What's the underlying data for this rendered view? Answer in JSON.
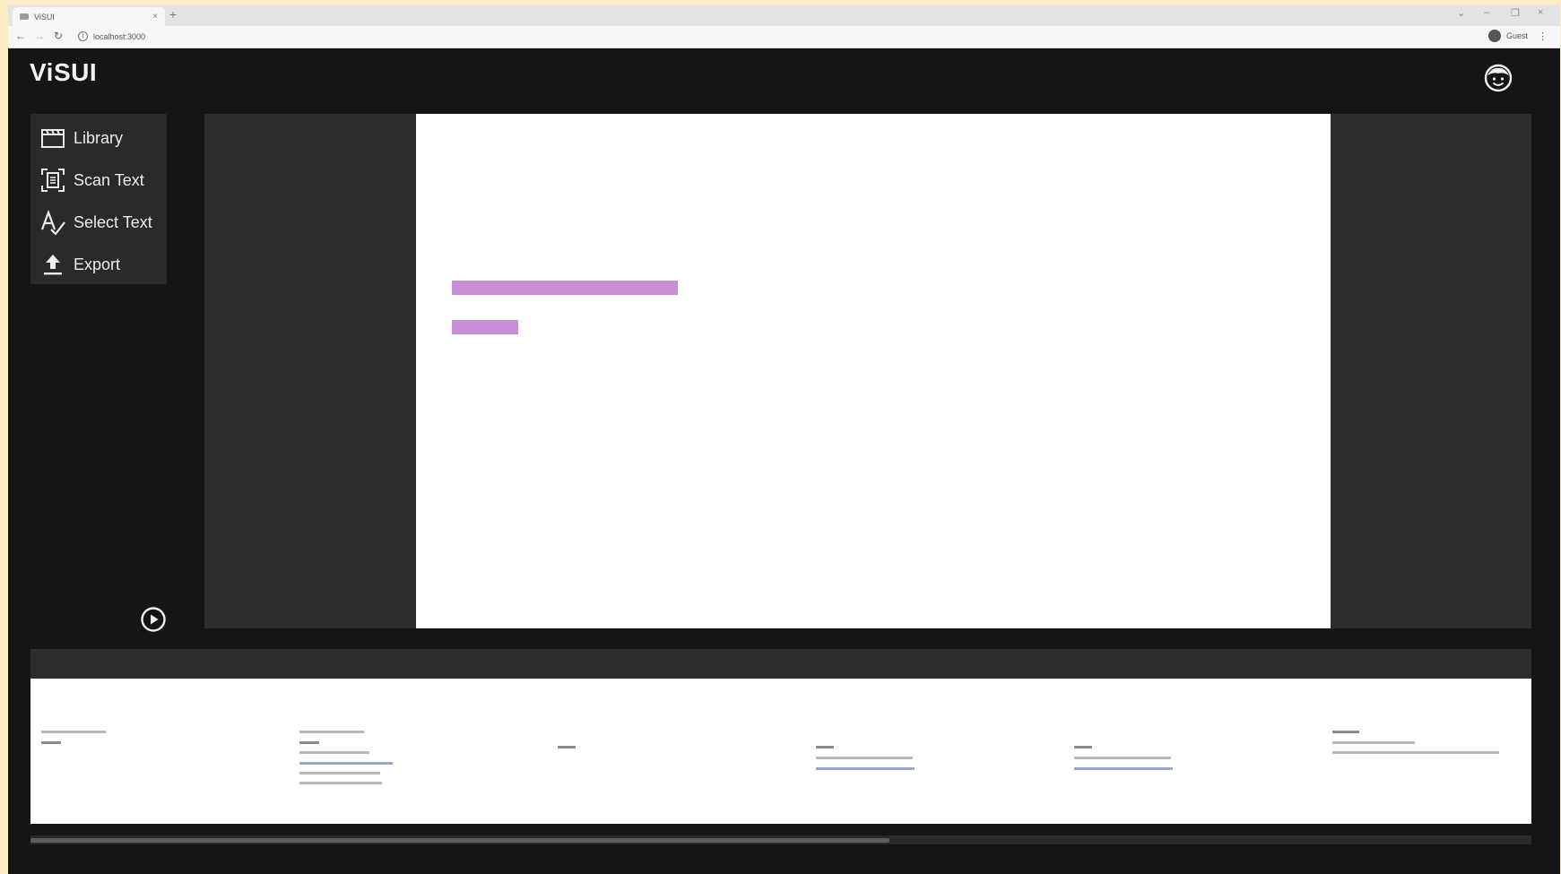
{
  "browser": {
    "tab_title": "ViSUI",
    "tab_close": "×",
    "new_tab": "+",
    "url": "localhost:3000",
    "profile_label": "Guest",
    "back": "←",
    "forward": "→",
    "reload": "↻",
    "menu": "⋮"
  },
  "app": {
    "logo": "ViSUI"
  },
  "sidebar": {
    "items": [
      {
        "label": "Library",
        "icon": "clapperboard-icon"
      },
      {
        "label": "Scan Text",
        "icon": "scan-document-icon"
      },
      {
        "label": "Select Text",
        "icon": "select-text-icon"
      },
      {
        "label": "Export",
        "icon": "export-upload-icon"
      }
    ]
  },
  "controls": {
    "play_icon": "play-circle-icon",
    "avatar_icon": "face-icon"
  },
  "colors": {
    "background": "#151515",
    "panel": "#2d2d2d",
    "highlight": "#c98fd6",
    "scroll_thumb": "#5c5c5c"
  },
  "timeline": {
    "scroll_position": 0.57,
    "thumbnail_count": 6
  }
}
